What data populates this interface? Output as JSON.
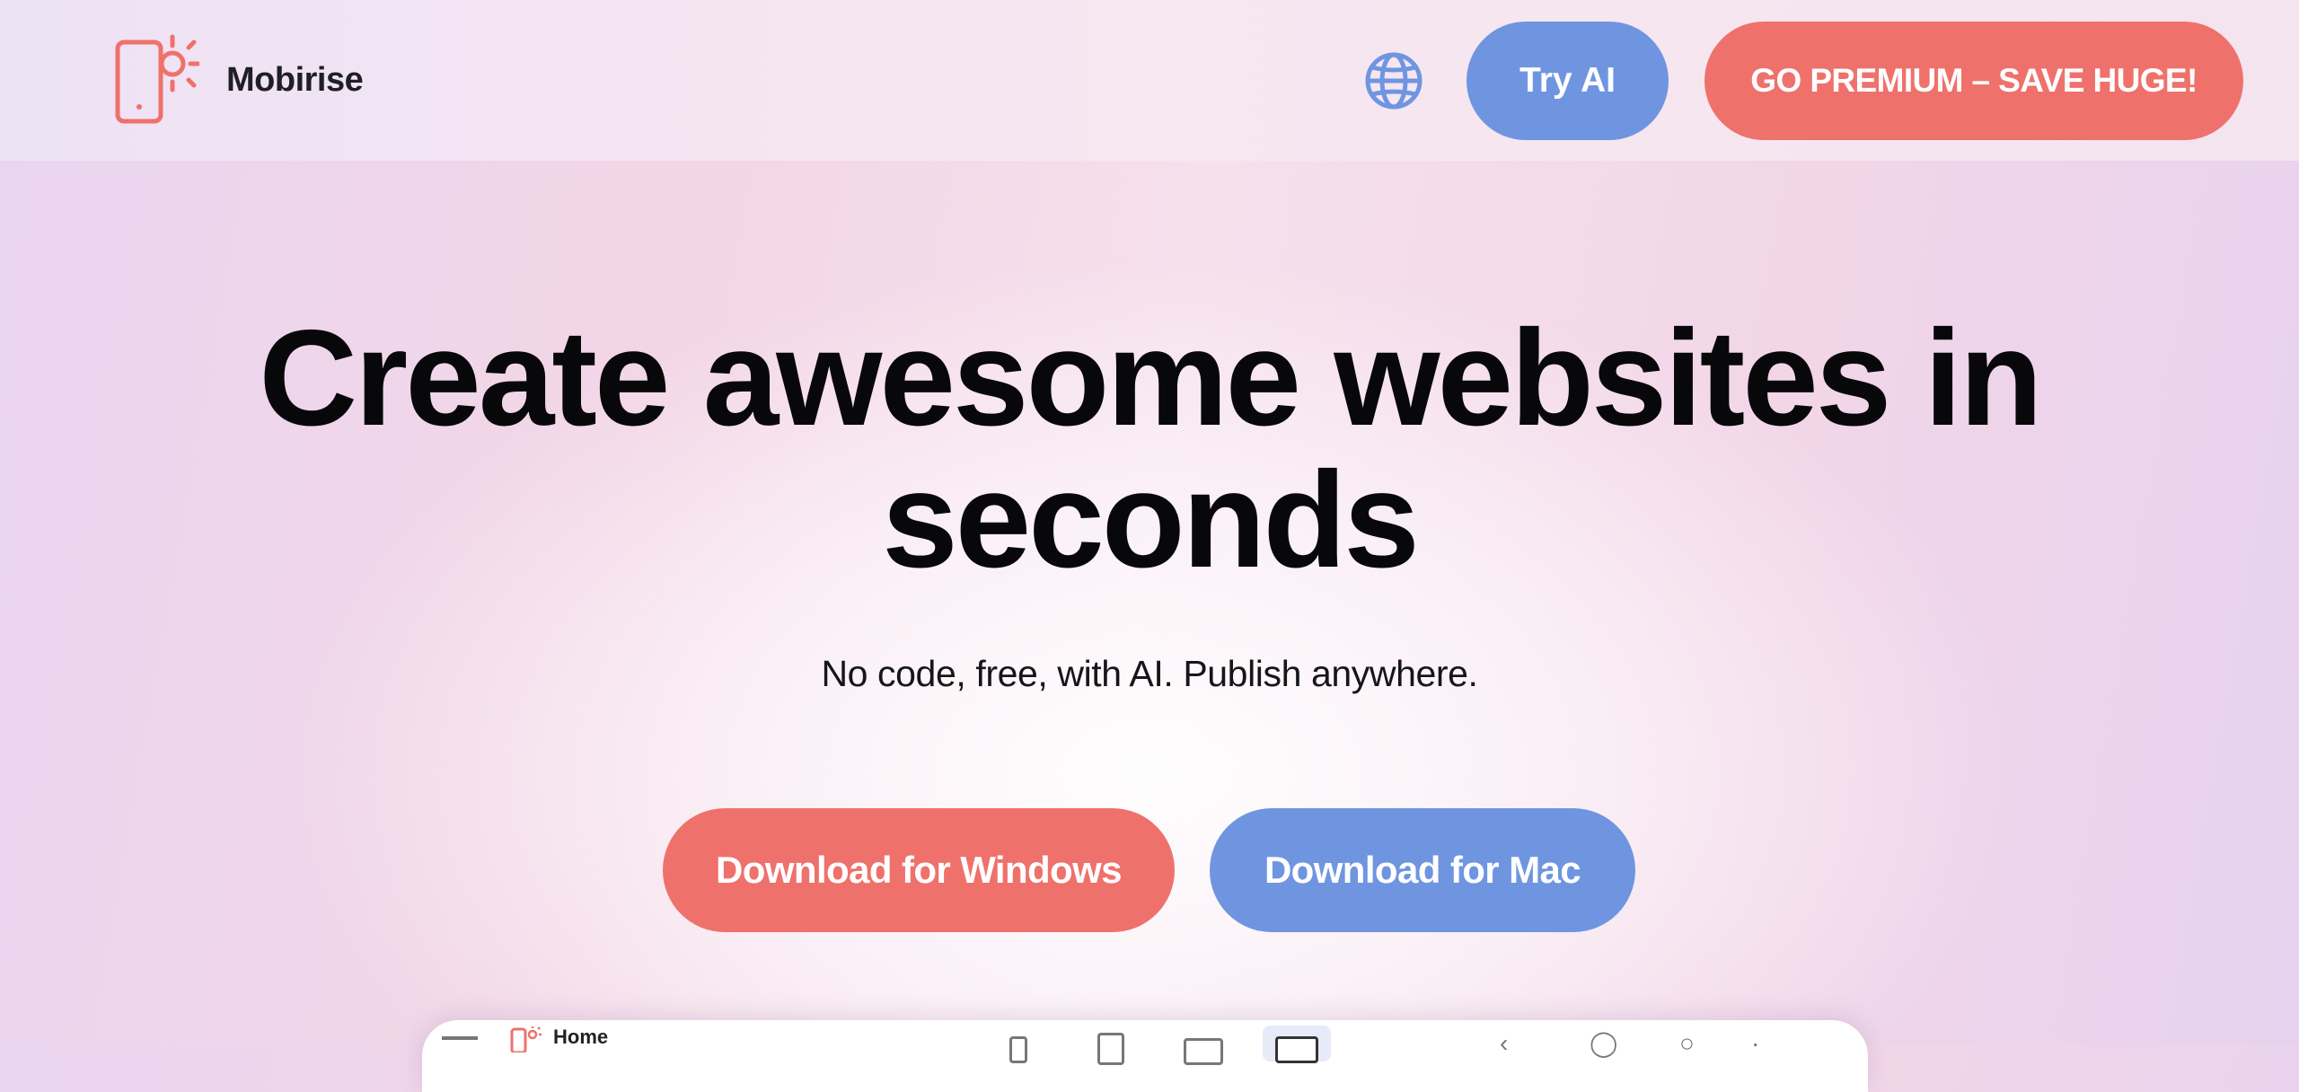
{
  "header": {
    "brand_name": "Mobirise",
    "logo_icon": "phone-sun-logo",
    "language_icon": "globe-icon",
    "try_ai_label": "Try AI",
    "premium_label": "GO PREMIUM – SAVE HUGE!"
  },
  "hero": {
    "title_line1": "Create awesome websites in",
    "title_line2": "seconds",
    "subtitle": "No code, free, with AI. Publish anywhere.",
    "download_windows_label": "Download for Windows",
    "download_mac_label": "Download for Mac"
  },
  "preview": {
    "page_label": "Home"
  },
  "colors": {
    "accent_red": "#ef716c",
    "accent_blue": "#6f95e1",
    "text_dark": "#08080b"
  }
}
